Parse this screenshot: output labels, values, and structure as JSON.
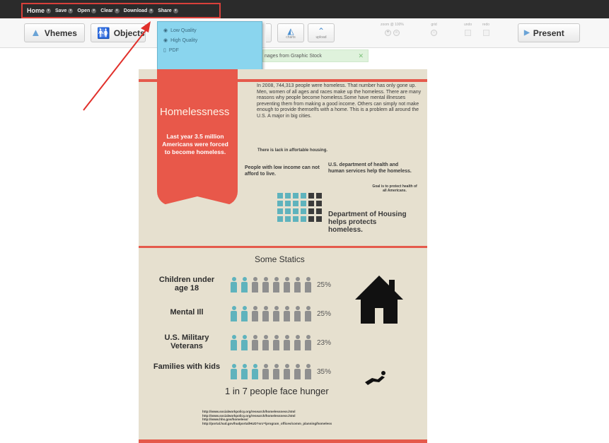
{
  "menu": {
    "items": [
      "Home",
      "Save",
      "Open",
      "Clear",
      "Download",
      "Share"
    ]
  },
  "toolbar": {
    "themes_label": "Vhemes",
    "objects_label": "Objects",
    "charts_label": "charts",
    "upload_label": "upload",
    "zoom_label": "zoom @ 100%",
    "grid_label": "grid",
    "undo_label": "undo",
    "redo_label": "redo",
    "present_label": "Present"
  },
  "download_menu": {
    "items": [
      {
        "label": "Low Quality",
        "icon": "radio-icon"
      },
      {
        "label": "High Quality",
        "icon": "radio-icon"
      },
      {
        "label": "PDF",
        "icon": "document-icon"
      }
    ]
  },
  "notice": {
    "text": "nages from Graphic Stock",
    "close": "✕"
  },
  "infographic": {
    "title": "Homelessness",
    "ribbon_text": "Last year 3.5 million Americans were forced to become homeless.",
    "intro": "In 2008, 744,313 people were homeless. That number has only gone up. Men, women of all ages and races make up the homeless. There are many reasons why people become homeless.Some have mental illnesses preventing them from making a good income. Others can simply not make enough to provide themselfs with a home.  This is a problem all around the U.S. A major in big cities.",
    "lack_housing": "There is lack in affortable housing.",
    "low_income": "People with low income can not afford to live.",
    "hhs": "U.S. department of health and human services help the homeless.",
    "goal": "Goal is to protect health of all Americans.",
    "housing": "Department of Housing helps protects homeless.",
    "stats_title": "Some Statics",
    "stats": [
      {
        "label": "Children under age 18",
        "pct": "25%",
        "highlight": 2
      },
      {
        "label": "Mental Ill",
        "pct": "25%",
        "highlight": 2
      },
      {
        "label": "U.S. Military Veterans",
        "pct": "23%",
        "highlight": 2
      },
      {
        "label": "Families with kids",
        "pct": "35%",
        "highlight": 3
      }
    ],
    "hunger": "1 in 7 people face hunger",
    "refs": [
      "http://www.socialworkpolicy.org/research/homelessness.html",
      "http://www.socialworkpolicy.org/research/homelessness.html",
      "http://www.hhs.gov/homeless/",
      "http://portal.hud.gov/hudportal/HUD?src=/program_offices/comm_planning/homeless"
    ]
  },
  "colors": {
    "accent_red": "#e8584a",
    "teal": "#5fb3bd",
    "gray_figure": "#8f8f8f",
    "dropdown_bg": "#8ad5ee"
  }
}
